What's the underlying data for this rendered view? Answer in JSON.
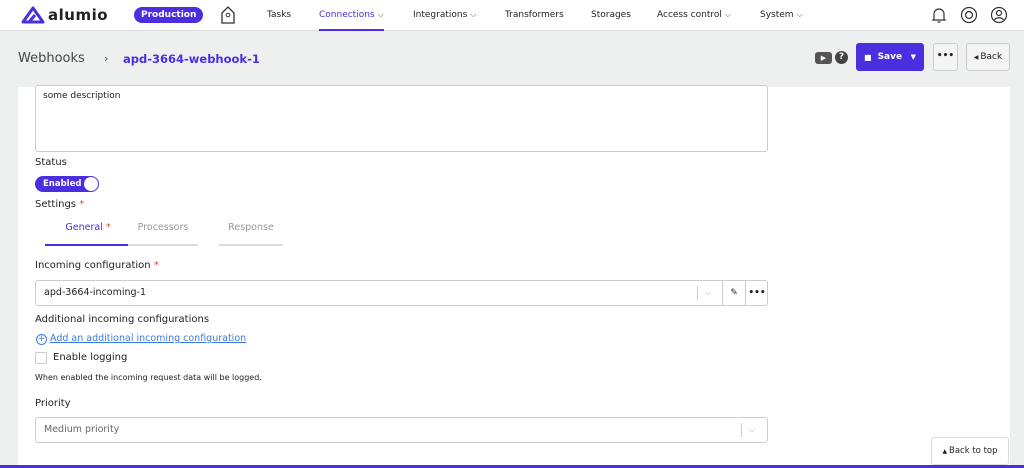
{
  "brand": {
    "name": "alumio",
    "environment": "Production",
    "accent": "#4a2ee0"
  },
  "nav": {
    "items": [
      {
        "label": "Tasks",
        "dropdown": false
      },
      {
        "label": "Connections",
        "dropdown": true,
        "active": true
      },
      {
        "label": "Integrations",
        "dropdown": true
      },
      {
        "label": "Transformers",
        "dropdown": false
      },
      {
        "label": "Storages",
        "dropdown": false
      },
      {
        "label": "Access control",
        "dropdown": true
      },
      {
        "label": "System",
        "dropdown": true
      }
    ]
  },
  "breadcrumb": {
    "parent": "Webhooks",
    "separator": "›",
    "current": "apd-3664-webhook-1"
  },
  "toolbar": {
    "save_label": "Save",
    "more_label": "•••",
    "back_label": "Back"
  },
  "form": {
    "description_value": "some description",
    "status_label": "Status",
    "status_value": "Enabled",
    "settings_label": "Settings",
    "tabs": [
      {
        "label": "General",
        "required": true
      },
      {
        "label": "Processors"
      },
      {
        "label": "Response"
      }
    ],
    "incoming_label": "Incoming configuration",
    "incoming_value": "apd-3664-incoming-1",
    "additional_label": "Additional incoming configurations",
    "add_link": "Add an additional incoming configuration",
    "logging_label": "Enable logging",
    "logging_checked": false,
    "logging_help": "When enabled the incoming request data will be logged.",
    "priority_label": "Priority",
    "priority_value": "Medium priority"
  },
  "back_to_top": "Back to top"
}
